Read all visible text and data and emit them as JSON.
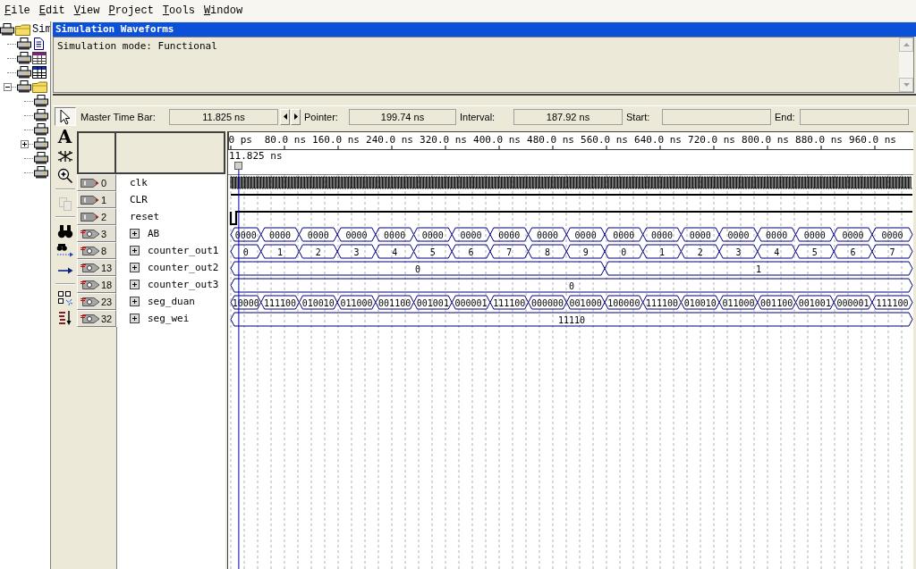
{
  "menu": [
    "File",
    "Edit",
    "View",
    "Project",
    "Tools",
    "Window"
  ],
  "project_tree": {
    "label": "Sim",
    "kind": "folder",
    "children": [
      {
        "kind": "document"
      },
      {
        "kind": "table"
      },
      {
        "kind": "grid"
      },
      {
        "kind": "folder",
        "expanded": true,
        "children": [
          {
            "kind": "printer"
          },
          {
            "kind": "printer"
          },
          {
            "kind": "printer"
          },
          {
            "kind": "printer",
            "expanded": false
          },
          {
            "kind": "printer"
          },
          {
            "kind": "printer"
          }
        ]
      }
    ]
  },
  "window": {
    "title": "Simulation Waveforms"
  },
  "message": "Simulation mode: Functional",
  "tools": [
    {
      "kind": "pointer",
      "selected": true,
      "disabled": false
    },
    {
      "kind": "text",
      "glyph": "A",
      "selected": false,
      "disabled": false
    },
    {
      "kind": "node",
      "selected": false,
      "disabled": false
    },
    {
      "kind": "zoom",
      "selected": false,
      "disabled": false
    },
    {
      "kind": "copy",
      "selected": false,
      "disabled": true
    },
    {
      "kind": "find",
      "selected": false,
      "disabled": false
    },
    {
      "kind": "find-next",
      "selected": false,
      "disabled": false
    },
    {
      "kind": "arrow",
      "selected": false,
      "disabled": false
    },
    {
      "kind": "grid",
      "selected": false,
      "disabled": false
    },
    {
      "kind": "sort",
      "selected": false,
      "disabled": false
    }
  ],
  "time_bar": [
    {
      "label": "Master Time Bar:",
      "value": "11.825 ns"
    },
    {
      "label": "Pointer:",
      "value": "199.74 ns"
    },
    {
      "label": "Interval:",
      "value": "187.92 ns"
    },
    {
      "label": "Start:"
    },
    {
      "label": "End:"
    }
  ],
  "timeline": {
    "labels": [
      "0 ps",
      "80.0 ns",
      "160.0 ns",
      "240.0 ns",
      "320.0 ns",
      "400.0 ns",
      "480.0 ns",
      "560.0 ns",
      "640.0 ns",
      "720.0 ns",
      "800.0 ns",
      "880.0 ns",
      "960.0 ns"
    ],
    "cursor_label": "11.825 ns"
  },
  "signals": [
    {
      "index": "0",
      "name": "clk",
      "output": false,
      "kind": "clock"
    },
    {
      "index": "1",
      "name": "CLR",
      "output": false,
      "kind": "high"
    },
    {
      "index": "2",
      "name": "reset",
      "output": false,
      "kind": "pulse-low"
    },
    {
      "index": "3",
      "name": "AB",
      "output": true,
      "kind": "bus",
      "expanded": false,
      "segments": [
        "0000",
        "0000",
        "0000",
        "0000",
        "0000",
        "0000",
        "0000",
        "0000",
        "0000",
        "0000",
        "0000",
        "0000",
        "0000",
        "0000",
        "0000",
        "0000",
        "0000",
        "0000"
      ]
    },
    {
      "index": "8",
      "name": "counter_out1",
      "output": true,
      "kind": "bus",
      "expanded": false,
      "segments": [
        "0",
        "1",
        "2",
        "3",
        "4",
        "5",
        "6",
        "7",
        "8",
        "9",
        "0",
        "1",
        "2",
        "3",
        "4",
        "5",
        "6",
        "7"
      ]
    },
    {
      "index": "13",
      "name": "counter_out2",
      "output": true,
      "kind": "bus",
      "expanded": false,
      "segments": [
        "0",
        "1"
      ]
    },
    {
      "index": "18",
      "name": "counter_out3",
      "output": true,
      "kind": "bus",
      "expanded": false,
      "segments": [
        "0"
      ]
    },
    {
      "index": "23",
      "name": "seg_duan",
      "output": true,
      "kind": "bus",
      "expanded": false,
      "segments": [
        "10000",
        "111100",
        "010010",
        "011000",
        "001100",
        "001001",
        "000001",
        "111100",
        "000000",
        "001000",
        "100000",
        "111100",
        "010010",
        "011000",
        "001100",
        "001001",
        "000001",
        "111100"
      ]
    },
    {
      "index": "32",
      "name": "seg_wei",
      "output": true,
      "kind": "bus",
      "expanded": false,
      "segments": [
        "11110"
      ]
    }
  ]
}
